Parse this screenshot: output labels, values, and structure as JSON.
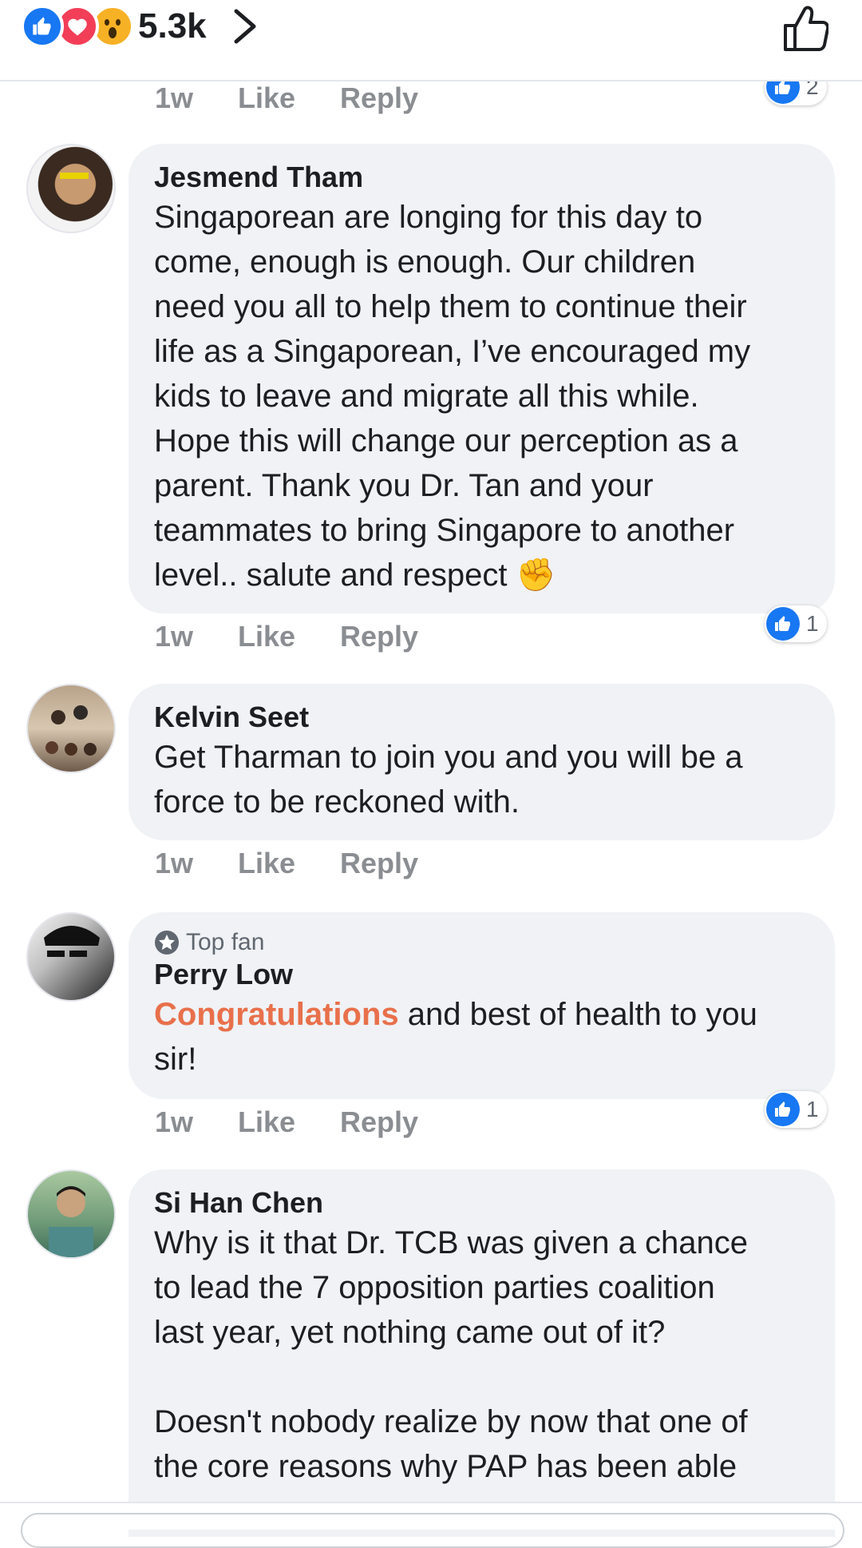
{
  "header": {
    "reaction_count": "5.3k",
    "reactions": [
      "like",
      "love",
      "wow"
    ]
  },
  "comments": [
    {
      "author": "",
      "time": "1w",
      "like_label": "Like",
      "reply_label": "Reply",
      "likes": "2"
    },
    {
      "author": "Jesmend Tham",
      "text": "Singaporean are longing for this day to\ncome, enough is enough. Our children\nneed you all to help them to continue their\nlife as a Singaporean, I’ve encouraged my\nkids to leave and migrate all this while.\nHope this will change our perception as a\nparent. Thank you Dr. Tan and your\nteammates to bring Singapore to another\nlevel.. salute and respect",
      "emoji": "✊",
      "time": "1w",
      "like_label": "Like",
      "reply_label": "Reply",
      "likes": "1"
    },
    {
      "author": "Kelvin Seet",
      "text": "Get Tharman to join you and you will be a\nforce to be reckoned with.",
      "time": "1w",
      "like_label": "Like",
      "reply_label": "Reply"
    },
    {
      "badge": "Top fan",
      "author": "Perry Low",
      "highlight": "Congratulations",
      "text": " and best of health to you\nsir!",
      "time": "1w",
      "like_label": "Like",
      "reply_label": "Reply",
      "likes": "1"
    },
    {
      "author": "Si Han Chen",
      "text": "Why is it that Dr. TCB was given a chance\nto lead the 7 opposition parties coalition\nlast year, yet nothing came out of it?\n\nDoesn't nobody realize by now that one of\nthe core reasons why PAP has been able"
    }
  ],
  "colors": {
    "accent": "#1877f2",
    "love": "#f33e58",
    "wow": "#f7b125",
    "highlight": "#e8704b",
    "bubble": "#f0f2f5"
  }
}
